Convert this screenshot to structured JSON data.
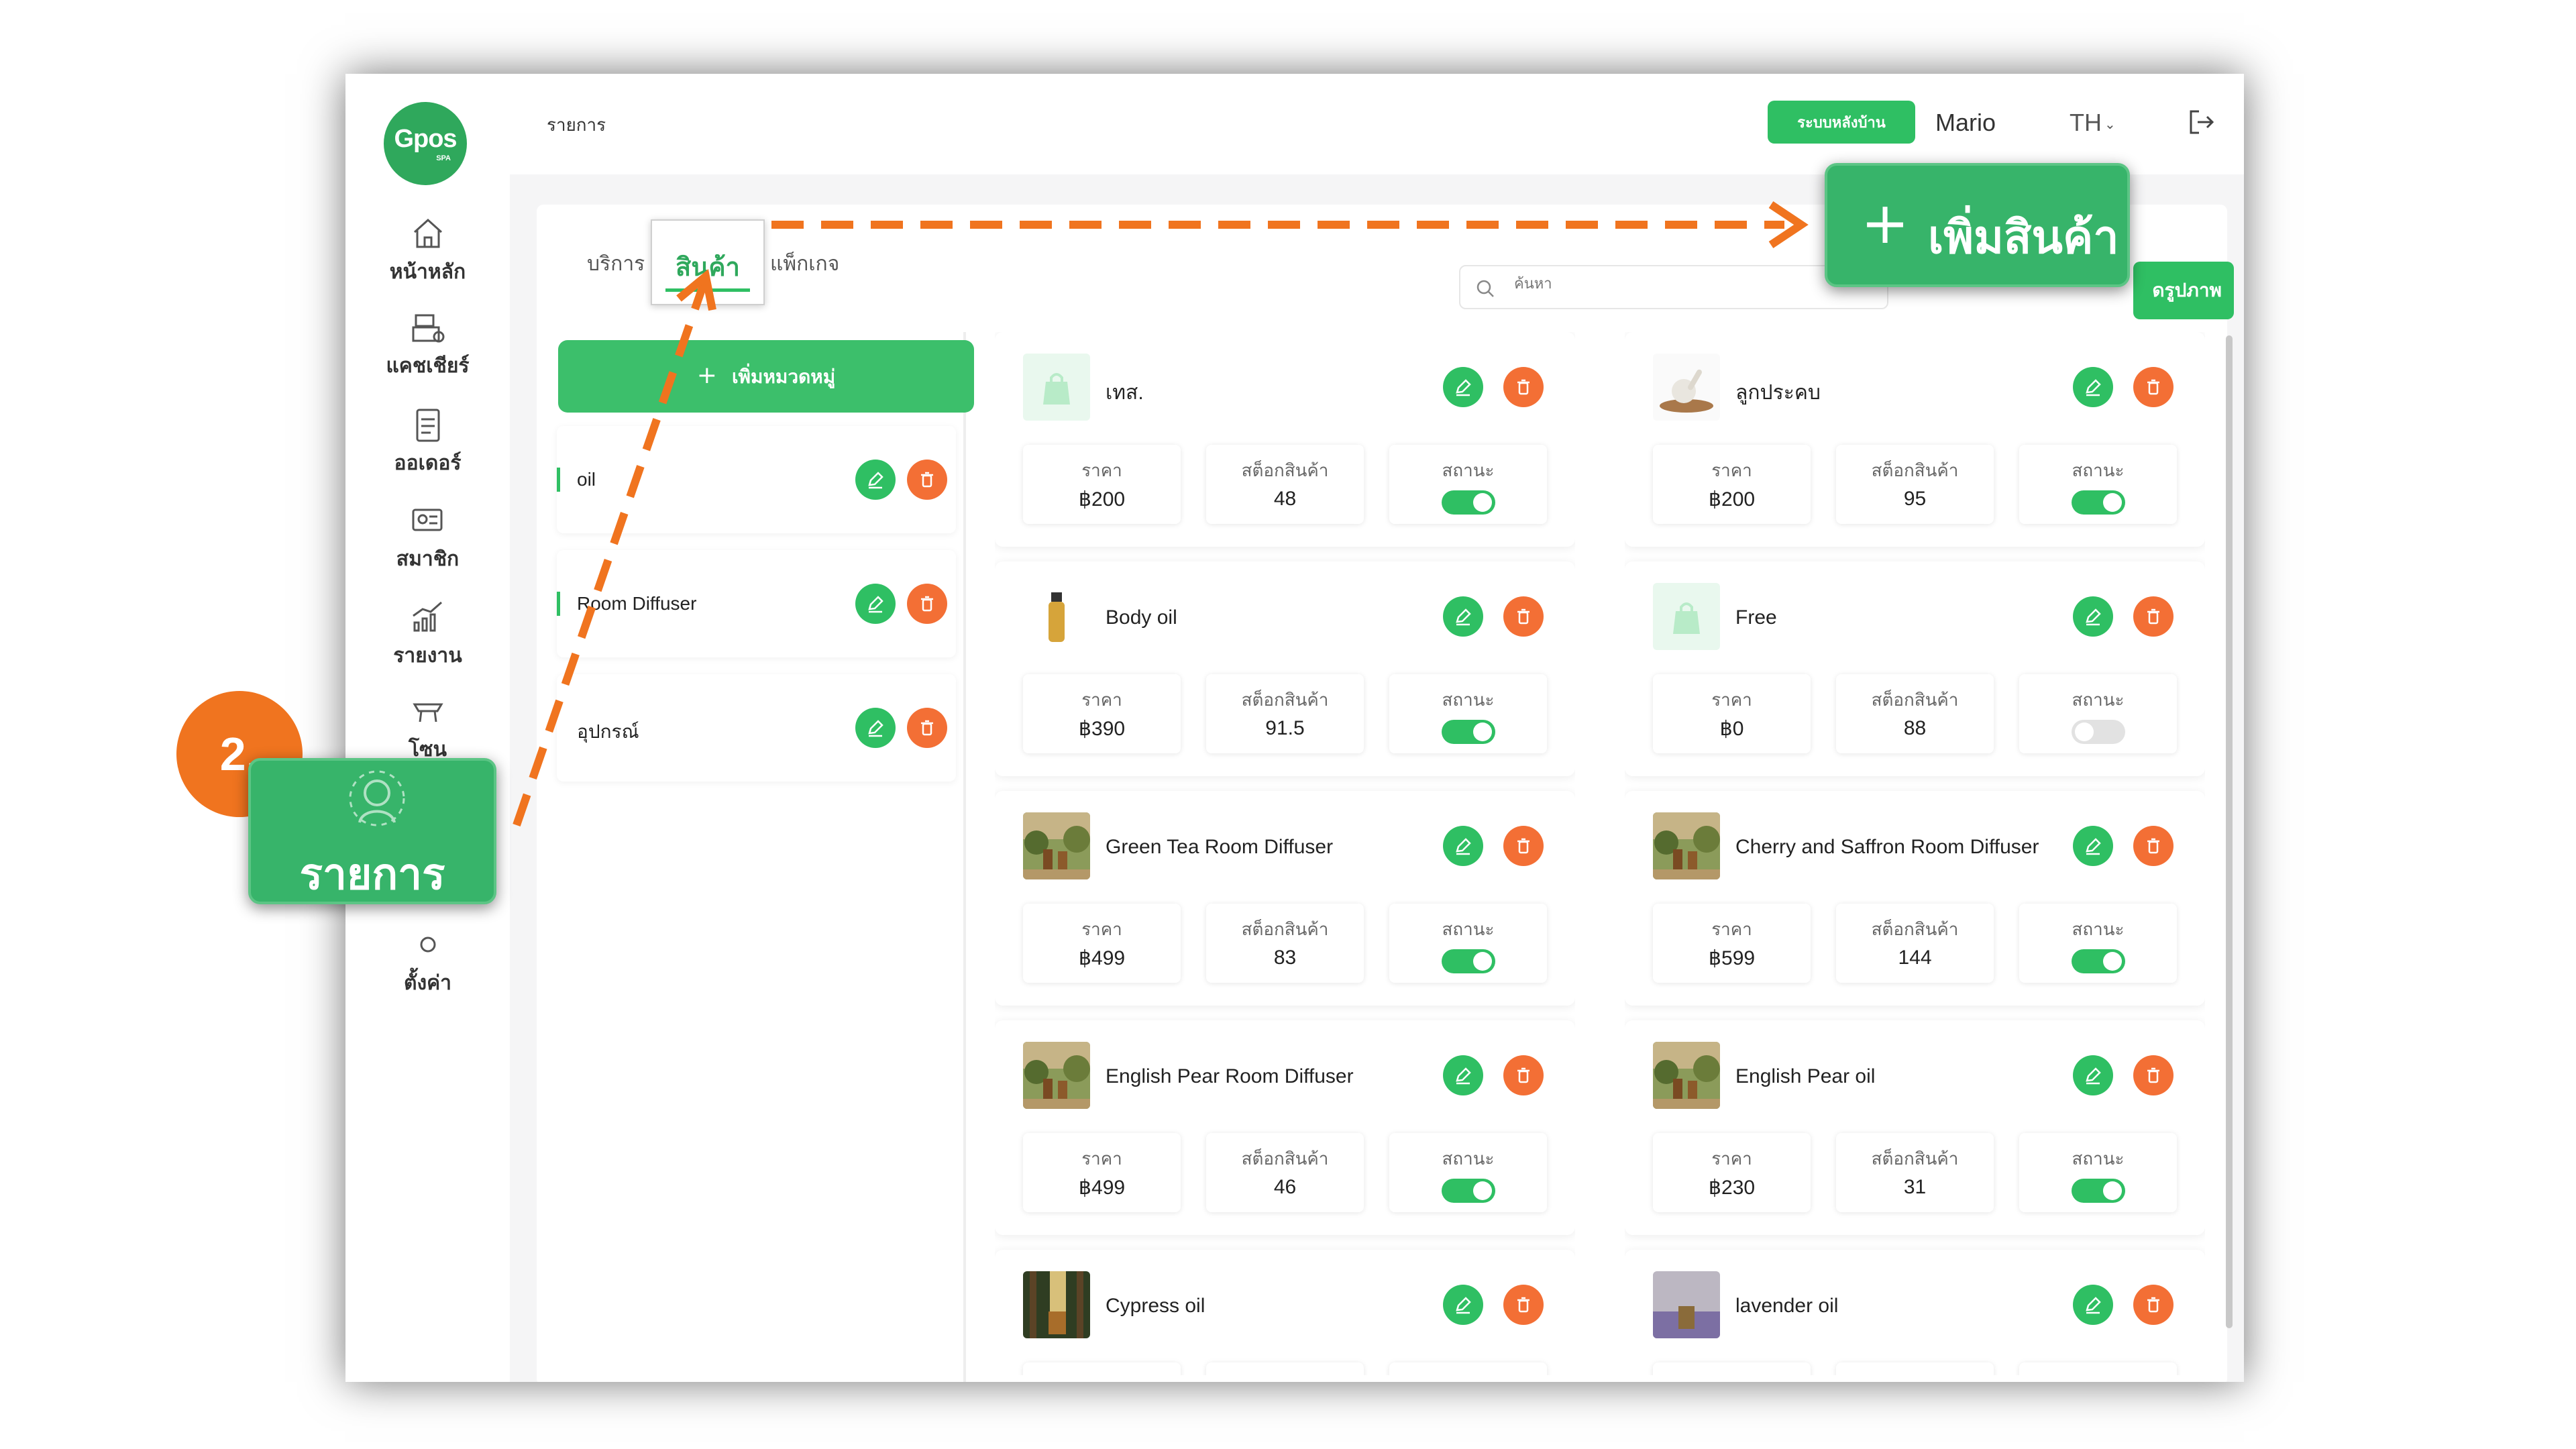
{
  "app": {
    "logo_text": "Gpos",
    "logo_sub": "SPA",
    "page_title": "รายการ",
    "backoffice_label": "ระบบหลังบ้าน",
    "user_name": "Mario",
    "language": "TH"
  },
  "sidebar": {
    "items": [
      {
        "label": "หน้าหลัก",
        "icon": "home-icon"
      },
      {
        "label": "แคชเชียร์",
        "icon": "cashier-icon"
      },
      {
        "label": "ออเดอร์",
        "icon": "order-clipboard-icon"
      },
      {
        "label": "สมาชิก",
        "icon": "member-card-icon"
      },
      {
        "label": "รายงาน",
        "icon": "report-chart-icon"
      },
      {
        "label": "โซน",
        "icon": "zone-icon"
      },
      {
        "label": "ตั้งค่า",
        "icon": "settings-gear-icon"
      }
    ]
  },
  "tabs": [
    {
      "label": "บริการ"
    },
    {
      "label": "สินค้า"
    },
    {
      "label": "แพ็กเกจ"
    }
  ],
  "search": {
    "placeholder": "ค้นหา"
  },
  "image_button_label": "ดรูปภาพ",
  "categories": {
    "add_label": "เพิ่มหมวดหมู่",
    "items": [
      {
        "label": "oil"
      },
      {
        "label": "Room Diffuser"
      },
      {
        "label": "อุปกรณ์"
      }
    ]
  },
  "product_labels": {
    "price": "ราคา",
    "stock": "สต็อกสินค้า",
    "status": "สถานะ"
  },
  "products": [
    {
      "name": "เทส.",
      "price": "฿200",
      "stock": "48",
      "active": true,
      "thumb": "bag"
    },
    {
      "name": "ลูกประคบ",
      "price": "฿200",
      "stock": "95",
      "active": true,
      "thumb": "herbal"
    },
    {
      "name": "Body oil",
      "price": "฿390",
      "stock": "91.5",
      "active": true,
      "thumb": "bottle"
    },
    {
      "name": "Free",
      "price": "฿0",
      "stock": "88",
      "active": false,
      "thumb": "bag"
    },
    {
      "name": "Green Tea Room Diffuser",
      "price": "฿499",
      "stock": "83",
      "active": true,
      "thumb": "garden"
    },
    {
      "name": "Cherry and Saffron Room Diffuser",
      "price": "฿599",
      "stock": "144",
      "active": true,
      "thumb": "garden"
    },
    {
      "name": "English Pear Room Diffuser",
      "price": "฿499",
      "stock": "46",
      "active": true,
      "thumb": "garden"
    },
    {
      "name": "English Pear oil",
      "price": "฿230",
      "stock": "31",
      "active": true,
      "thumb": "garden"
    },
    {
      "name": "Cypress oil",
      "price": "",
      "stock": "",
      "active": true,
      "thumb": "forest"
    },
    {
      "name": "lavender oil",
      "price": "",
      "stock": "",
      "active": true,
      "thumb": "lavender"
    }
  ],
  "annotations": {
    "step_number": "2.",
    "menu_callout": "รายการ",
    "add_callout": "เพิ่มสินค้า",
    "plus": "+"
  },
  "colors": {
    "primary": "#2fbf63",
    "danger": "#f36f35",
    "annotation": "#f0741f"
  }
}
